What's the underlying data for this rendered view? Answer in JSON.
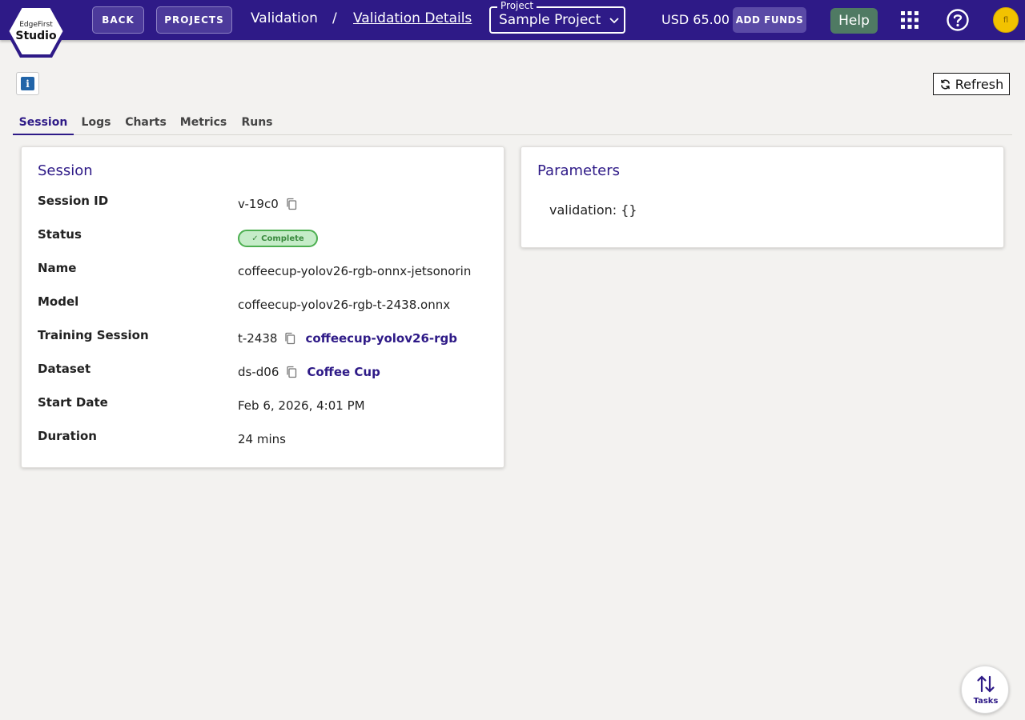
{
  "header": {
    "logo_small": "EdgeFirst",
    "logo_big": "Studio",
    "back_label": "BACK",
    "projects_label": "PROJECTS",
    "breadcrumb": {
      "section": "Validation",
      "separator": "/",
      "page": "Validation Details"
    },
    "project_select": {
      "label": "Project",
      "value": "Sample Project"
    },
    "balance": "USD 65.00",
    "add_funds_label": "ADD FUNDS",
    "help_label": "Help",
    "avatar_initials": "fl",
    "colors": {
      "bar": "#2e1a87",
      "help": "#4f7a63",
      "avatar": "#f2c200"
    }
  },
  "toolbar": {
    "refresh_label": "Refresh"
  },
  "tabs": [
    {
      "label": "Session",
      "active": true
    },
    {
      "label": "Logs",
      "active": false
    },
    {
      "label": "Charts",
      "active": false
    },
    {
      "label": "Metrics",
      "active": false
    },
    {
      "label": "Runs",
      "active": false
    }
  ],
  "session": {
    "title": "Session",
    "rows": [
      {
        "label": "Session ID",
        "value": "v-19c0"
      },
      {
        "label": "Status",
        "value": "✓ Complete"
      },
      {
        "label": "Name",
        "value": "coffeecup-yolov26-rgb-onnx-jetsonorin"
      },
      {
        "label": "Model",
        "value": "coffeecup-yolov26-rgb-t-2438.onnx"
      },
      {
        "label": "Training Session",
        "value": "t-2438",
        "link": "coffeecup-yolov26-rgb"
      },
      {
        "label": "Dataset",
        "value": "ds-d06",
        "link": "Coffee Cup"
      },
      {
        "label": "Start Date",
        "value": "Feb 6, 2026, 4:01 PM"
      },
      {
        "label": "Duration",
        "value": "24 mins"
      }
    ]
  },
  "parameters": {
    "title": "Parameters",
    "text": "validation: {}"
  },
  "tasks": {
    "label": "Tasks"
  }
}
